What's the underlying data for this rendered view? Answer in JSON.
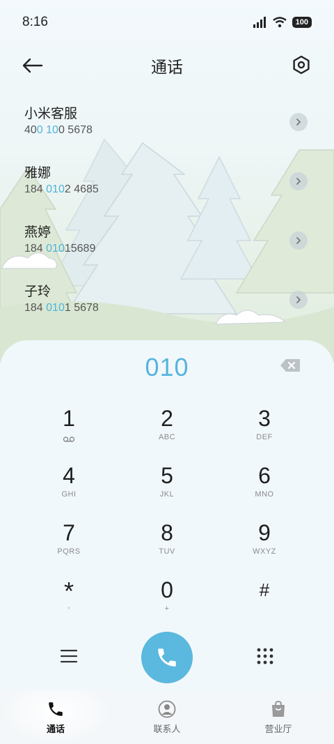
{
  "status_bar": {
    "time": "8:16",
    "battery": "100"
  },
  "header": {
    "title": "通话",
    "back_icon": "arrow-left-icon",
    "settings_icon": "hexagon-gear-icon"
  },
  "contacts": [
    {
      "name": "小米客服",
      "number_parts": [
        "40",
        "0",
        " ",
        "10",
        "0 5678"
      ],
      "highlight": [
        false,
        true,
        false,
        true,
        false
      ]
    },
    {
      "name": "雅娜",
      "number_parts": [
        "184 ",
        "010",
        "2 4685"
      ],
      "highlight": [
        false,
        true,
        false
      ]
    },
    {
      "name": "燕婷",
      "number_parts": [
        "184 ",
        "010",
        "15689"
      ],
      "highlight": [
        false,
        true,
        false
      ]
    },
    {
      "name": "子玲",
      "number_parts": [
        "184 ",
        "010",
        "1 5678"
      ],
      "highlight": [
        false,
        true,
        false
      ]
    }
  ],
  "dialer": {
    "input_value": "010",
    "keys": [
      {
        "digit": "1",
        "letters": "voicemail"
      },
      {
        "digit": "2",
        "letters": "ABC"
      },
      {
        "digit": "3",
        "letters": "DEF"
      },
      {
        "digit": "4",
        "letters": "GHI"
      },
      {
        "digit": "5",
        "letters": "JKL"
      },
      {
        "digit": "6",
        "letters": "MNO"
      },
      {
        "digit": "7",
        "letters": "PQRS"
      },
      {
        "digit": "8",
        "letters": "TUV"
      },
      {
        "digit": "9",
        "letters": "WXYZ"
      },
      {
        "digit": "*",
        "letters": ","
      },
      {
        "digit": "0",
        "letters": "+"
      },
      {
        "digit": "#",
        "letters": ""
      }
    ]
  },
  "bottom_nav": {
    "items": [
      {
        "label": "通话",
        "icon": "phone-icon",
        "active": true
      },
      {
        "label": "联系人",
        "icon": "contact-person-icon",
        "active": false
      },
      {
        "label": "营业厅",
        "icon": "shopping-bag-icon",
        "active": false
      }
    ]
  },
  "colors": {
    "accent": "#56b4dc",
    "call_button": "#5bb8de"
  }
}
